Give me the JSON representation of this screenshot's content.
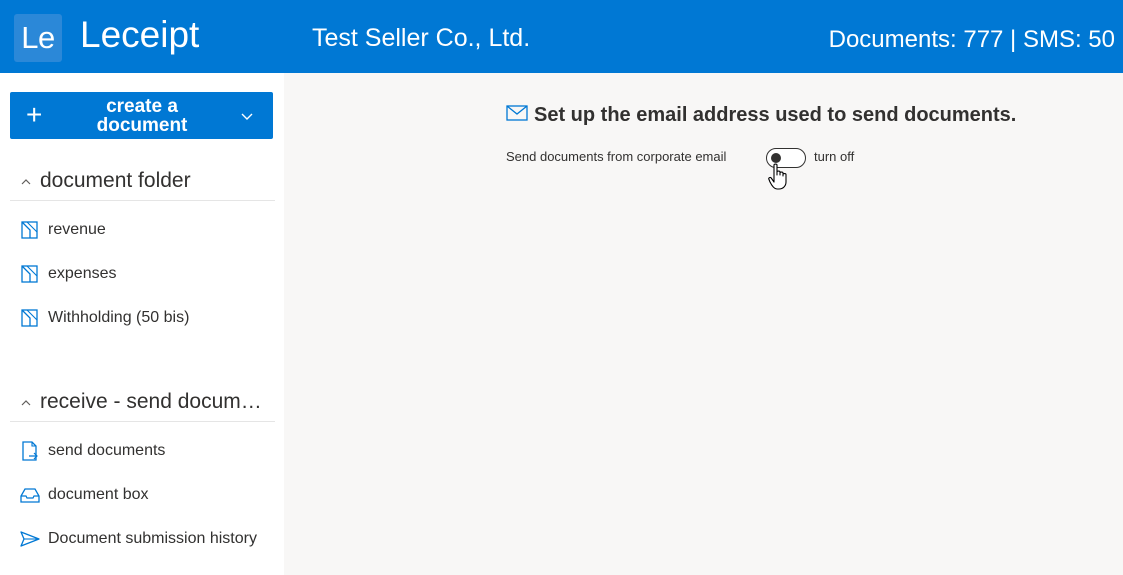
{
  "header": {
    "logo_text": "Le",
    "app_name": "Leceipt",
    "company_name": "Test Seller Co., Ltd.",
    "quota_text": "Documents: 777 | SMS: 50"
  },
  "sidebar": {
    "create_button": {
      "label": "create a document"
    },
    "groups": [
      {
        "title": "document folder",
        "items": [
          {
            "label": "revenue",
            "icon": "folder-icon"
          },
          {
            "label": "expenses",
            "icon": "folder-icon"
          },
          {
            "label": "Withholding (50 bis)",
            "icon": "folder-icon"
          }
        ]
      },
      {
        "title": "receive - send documents",
        "items": [
          {
            "label": "send documents",
            "icon": "send-document-icon"
          },
          {
            "label": "document box",
            "icon": "inbox-icon"
          },
          {
            "label": "Document submission history",
            "icon": "send-icon"
          }
        ]
      }
    ]
  },
  "main": {
    "title": "Set up the email address used to send documents.",
    "toggle": {
      "label": "Send documents from corporate email",
      "state_text": "turn off",
      "on": false
    }
  },
  "colors": {
    "brand": "#0078d4",
    "logo_box": "#2b88d8",
    "content_bg": "#f8f7f6",
    "text": "#323130"
  }
}
